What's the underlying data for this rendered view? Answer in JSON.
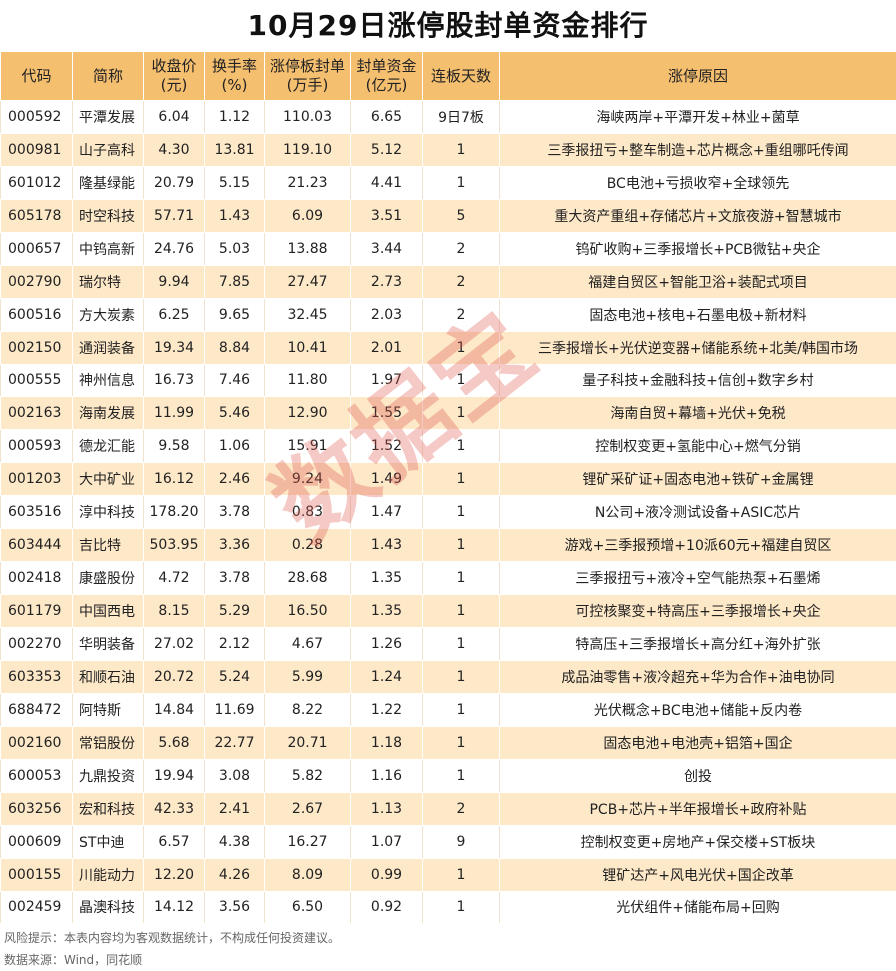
{
  "title": "10月29日涨停股封单资金排行",
  "headers": [
    "代码",
    "简称",
    "收盘价\n(元)",
    "换手率\n(%)",
    "涨停板封单\n(万手)",
    "封单资金\n(亿元)",
    "连板天数",
    "涨停原因"
  ],
  "rows": [
    [
      "000592",
      "平潭发展",
      "6.04",
      "1.12",
      "110.03",
      "6.65",
      "9日7板",
      "海峡两岸+平潭开发+林业+菌草"
    ],
    [
      "000981",
      "山子高科",
      "4.30",
      "13.81",
      "119.10",
      "5.12",
      "1",
      "三季报扭亏+整车制造+芯片概念+重组哪吒传闻"
    ],
    [
      "601012",
      "隆基绿能",
      "20.79",
      "5.15",
      "21.23",
      "4.41",
      "1",
      "BC电池+亏损收窄+全球领先"
    ],
    [
      "605178",
      "时空科技",
      "57.71",
      "1.43",
      "6.09",
      "3.51",
      "5",
      "重大资产重组+存储芯片+文旅夜游+智慧城市"
    ],
    [
      "000657",
      "中钨高新",
      "24.76",
      "5.03",
      "13.88",
      "3.44",
      "2",
      "钨矿收购+三季报增长+PCB微钻+央企"
    ],
    [
      "002790",
      "瑞尔特",
      "9.94",
      "7.85",
      "27.47",
      "2.73",
      "2",
      "福建自贸区+智能卫浴+装配式项目"
    ],
    [
      "600516",
      "方大炭素",
      "6.25",
      "9.65",
      "32.45",
      "2.03",
      "2",
      "固态电池+核电+石墨电极+新材料"
    ],
    [
      "002150",
      "通润装备",
      "19.34",
      "8.84",
      "10.41",
      "2.01",
      "1",
      "三季报增长+光伏逆变器+储能系统+北美/韩国市场"
    ],
    [
      "000555",
      "神州信息",
      "16.73",
      "7.46",
      "11.80",
      "1.97",
      "1",
      "量子科技+金融科技+信创+数字乡村"
    ],
    [
      "002163",
      "海南发展",
      "11.99",
      "5.46",
      "12.90",
      "1.55",
      "1",
      "海南自贸+幕墙+光伏+免税"
    ],
    [
      "000593",
      "德龙汇能",
      "9.58",
      "1.06",
      "15.91",
      "1.52",
      "1",
      "控制权变更+氢能中心+燃气分销"
    ],
    [
      "001203",
      "大中矿业",
      "16.12",
      "2.46",
      "9.24",
      "1.49",
      "1",
      "锂矿采矿证+固态电池+铁矿+金属锂"
    ],
    [
      "603516",
      "淳中科技",
      "178.20",
      "3.78",
      "0.83",
      "1.47",
      "1",
      "N公司+液冷测试设备+ASIC芯片"
    ],
    [
      "603444",
      "吉比特",
      "503.95",
      "3.36",
      "0.28",
      "1.43",
      "1",
      "游戏+三季报预增+10派60元+福建自贸区"
    ],
    [
      "002418",
      "康盛股份",
      "4.72",
      "3.78",
      "28.68",
      "1.35",
      "1",
      "三季报扭亏+液冷+空气能热泵+石墨烯"
    ],
    [
      "601179",
      "中国西电",
      "8.15",
      "5.29",
      "16.50",
      "1.35",
      "1",
      "可控核聚变+特高压+三季报增长+央企"
    ],
    [
      "002270",
      "华明装备",
      "27.02",
      "2.12",
      "4.67",
      "1.26",
      "1",
      "特高压+三季报增长+高分红+海外扩张"
    ],
    [
      "603353",
      "和顺石油",
      "20.72",
      "5.24",
      "5.99",
      "1.24",
      "1",
      "成品油零售+液冷超充+华为合作+油电协同"
    ],
    [
      "688472",
      "阿特斯",
      "14.84",
      "11.69",
      "8.22",
      "1.22",
      "1",
      "光伏概念+BC电池+储能+反内卷"
    ],
    [
      "002160",
      "常铝股份",
      "5.68",
      "22.77",
      "20.71",
      "1.18",
      "1",
      "固态电池+电池壳+铝箔+国企"
    ],
    [
      "600053",
      "九鼎投资",
      "19.94",
      "3.08",
      "5.82",
      "1.16",
      "1",
      "创投"
    ],
    [
      "603256",
      "宏和科技",
      "42.33",
      "2.41",
      "2.67",
      "1.13",
      "2",
      "PCB+芯片+半年报增长+政府补贴"
    ],
    [
      "000609",
      "ST中迪",
      "6.57",
      "4.38",
      "16.27",
      "1.07",
      "9",
      "控制权变更+房地产+保交楼+ST板块"
    ],
    [
      "000155",
      "川能动力",
      "12.20",
      "4.26",
      "8.09",
      "0.99",
      "1",
      "锂矿达产+风电光伏+国企改革"
    ],
    [
      "002459",
      "晶澳科技",
      "14.12",
      "3.56",
      "6.50",
      "0.92",
      "1",
      "光伏组件+储能布局+回购"
    ]
  ],
  "footer": {
    "disclaimer": "风险提示：本表内容均为客观数据统计，不构成任何投资建议。",
    "source": "数据来源：Wind，同花顺"
  },
  "watermark": "数据宝",
  "colors": {
    "header_bg": "#f5bf70",
    "stripe_bg": "#fde8c8",
    "watermark": "#e15a50"
  }
}
